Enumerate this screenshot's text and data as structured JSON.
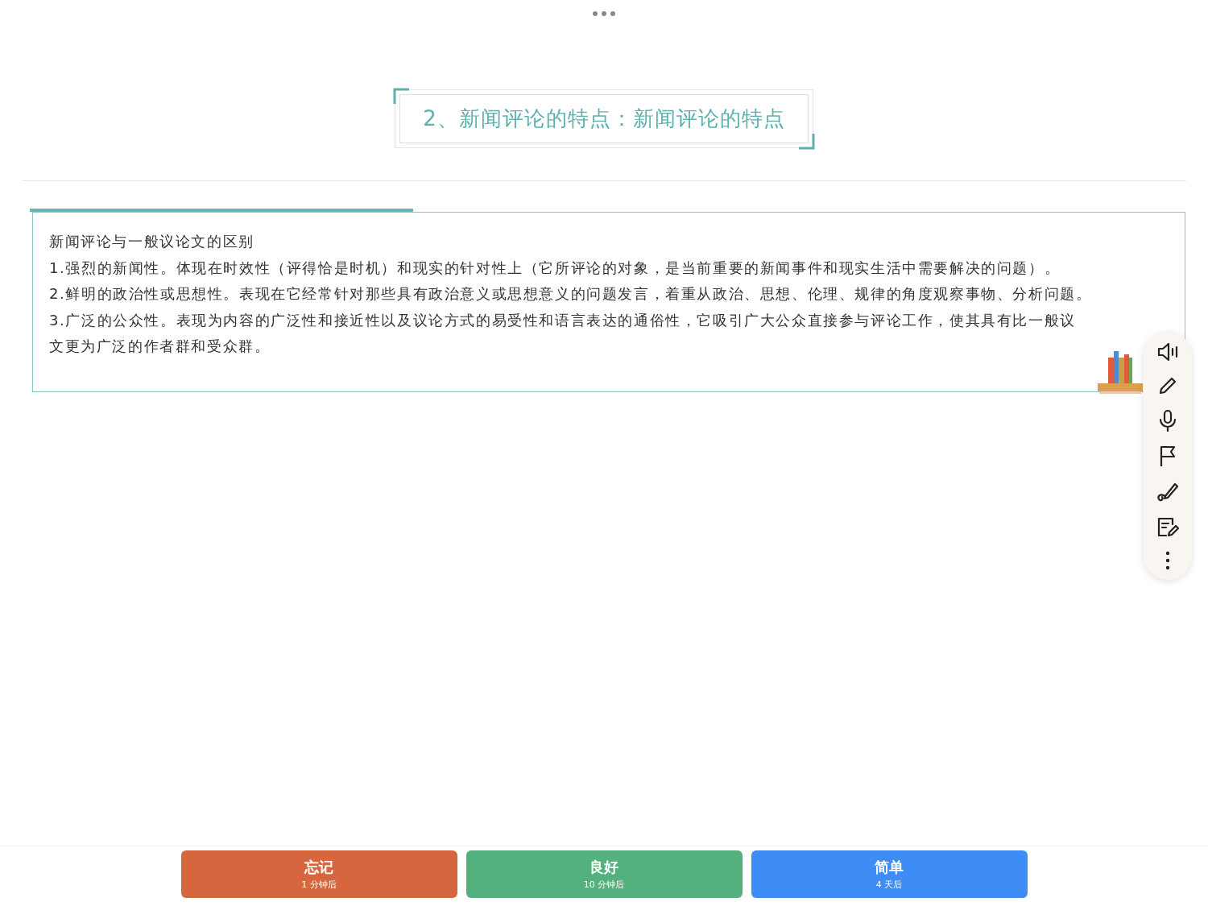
{
  "title": "2、新闻评论的特点：新闻评论的特点",
  "note": {
    "lines": [
      "新闻评论与一般议论文的区别",
      "1.强烈的新闻性。体现在时效性（评得恰是时机）和现实的针对性上（它所评论的对象，是当前重要的新闻事件和现实生活中需要解决的问题）。",
      "2.鲜明的政治性或思想性。表现在它经常针对那些具有政治意义或思想意义的问题发言，着重从政治、思想、伦理、规律的角度观察事物、分析问题。",
      "3.广泛的公众性。表现为内容的广泛性和接近性以及议论方式的易受性和语言表达的通俗性，它吸引广大公众直接参与评论工作，使其具有比一般议",
      "文更为广泛的作者群和受众群。"
    ]
  },
  "tools": [
    {
      "kind": "speaker"
    },
    {
      "kind": "pencil"
    },
    {
      "kind": "mic"
    },
    {
      "kind": "flag"
    },
    {
      "kind": "draw"
    },
    {
      "kind": "note"
    },
    {
      "kind": "more"
    }
  ],
  "ratings": [
    {
      "label": "忘记",
      "interval": "1 分钟后",
      "color": "#d6663d"
    },
    {
      "label": "良好",
      "interval": "10 分钟后",
      "color": "#54b07c"
    },
    {
      "label": "简单",
      "interval": "4 天后",
      "color": "#3e8cf5"
    }
  ]
}
